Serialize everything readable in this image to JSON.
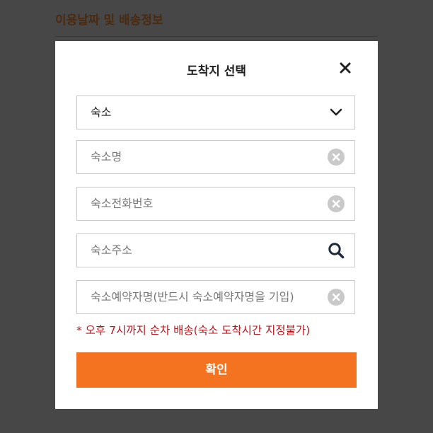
{
  "background": {
    "section_title": "이용날짜 및 배송정보"
  },
  "modal": {
    "title": "도착지 선택",
    "select": {
      "value": "숙소",
      "icon": "chevron-down-icon"
    },
    "fields": [
      {
        "placeholder": "숙소명",
        "icon": "clear-icon"
      },
      {
        "placeholder": "숙소전화번호",
        "icon": "clear-icon"
      },
      {
        "placeholder": "숙소주소",
        "icon": "search-icon"
      },
      {
        "placeholder": "숙소예약자명(반드시 숙소예약자명을 기입)",
        "icon": "clear-icon"
      }
    ],
    "note": "* 오후 7시까지 순차 배송(숙소 도착시간 지정불가)",
    "confirm_label": "확인"
  },
  "colors": {
    "overlay": "#474747",
    "accent": "#f47321",
    "note": "#c0141a",
    "field_border": "#c8c8c8"
  }
}
